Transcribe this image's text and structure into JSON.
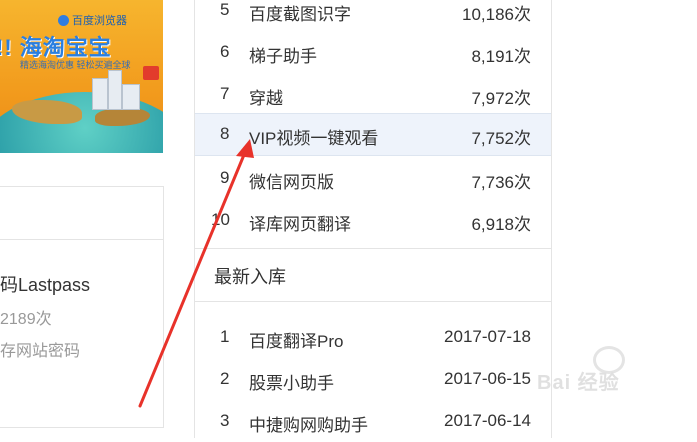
{
  "banner": {
    "brand": "百度浏览器",
    "title": "!! 海淘宝宝",
    "tagline": "精选海淘优惠 轻松买遍全球"
  },
  "card": {
    "name": "码Lastpass",
    "count": "2189次",
    "desc": "存网站密码"
  },
  "ranking": {
    "items": [
      {
        "rank": "5",
        "label": "百度截图识字",
        "value": "10,186次"
      },
      {
        "rank": "6",
        "label": "梯子助手",
        "value": "8,191次"
      },
      {
        "rank": "7",
        "label": "穿越",
        "value": "7,972次"
      },
      {
        "rank": "8",
        "label": "VIP视频一键观看",
        "value": "7,752次"
      },
      {
        "rank": "9",
        "label": "微信网页版",
        "value": "7,736次"
      },
      {
        "rank": "10",
        "label": "译库网页翻译",
        "value": "6,918次"
      }
    ]
  },
  "newest": {
    "title": "最新入库",
    "items": [
      {
        "rank": "1",
        "label": "百度翻译Pro",
        "value": "2017-07-18"
      },
      {
        "rank": "2",
        "label": "股票小助手",
        "value": "2017-06-15"
      },
      {
        "rank": "3",
        "label": "中捷购网购助手",
        "value": "2017-06-14"
      }
    ]
  },
  "watermark": {
    "text": "Bai 经验"
  },
  "colors": {
    "highlight_row": "#eef3fb",
    "arrow": "#e8322a",
    "border": "#e4e4e4"
  }
}
